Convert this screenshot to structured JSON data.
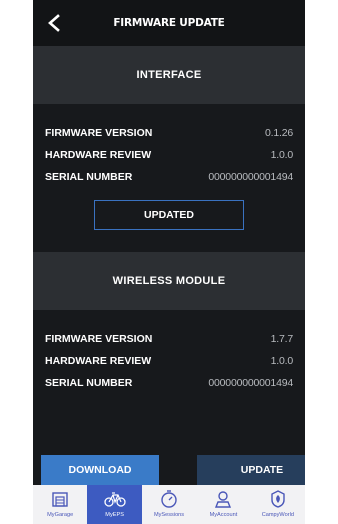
{
  "header": {
    "title": "FIRMWARE UPDATE"
  },
  "interface": {
    "title": "INTERFACE",
    "rows": [
      {
        "label": "FIRMWARE VERSION",
        "value": "0.1.26"
      },
      {
        "label": "HARDWARE REVIEW",
        "value": "1.0.0"
      },
      {
        "label": "SERIAL NUMBER",
        "value": "000000000001494"
      }
    ],
    "status_button": "UPDATED"
  },
  "wireless": {
    "title": "WIRELESS MODULE",
    "rows": [
      {
        "label": "FIRMWARE VERSION",
        "value": "1.7.7"
      },
      {
        "label": "HARDWARE REVIEW",
        "value": "1.0.0"
      },
      {
        "label": "SERIAL NUMBER",
        "value": "000000000001494"
      }
    ],
    "download_label": "DOWNLOAD",
    "update_label": "UPDATE"
  },
  "tabbar": {
    "items": [
      {
        "label": "MyGarage",
        "icon": "garage-icon",
        "active": false
      },
      {
        "label": "MyEPS",
        "icon": "bike-icon",
        "active": true
      },
      {
        "label": "MySessions",
        "icon": "stopwatch-icon",
        "active": false
      },
      {
        "label": "MyAccount",
        "icon": "user-icon",
        "active": false
      },
      {
        "label": "CampyWorld",
        "icon": "campyworld-icon",
        "active": false
      }
    ]
  },
  "colors": {
    "accent_blue": "#3a7bc8",
    "dark_blue": "#263e5c",
    "tab_active": "#3d5bc1",
    "background": "#17191c",
    "section_header": "#2c2f33"
  }
}
